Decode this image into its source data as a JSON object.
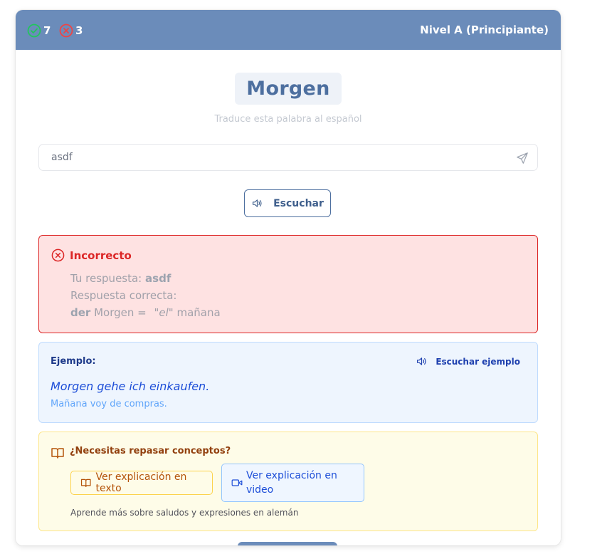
{
  "header": {
    "correct_count": "7",
    "wrong_count": "3",
    "level": "Nivel A (Principiante)"
  },
  "word": {
    "text": "Morgen",
    "instruction": "Traduce esta palabra al español"
  },
  "answer": {
    "value": "asdf"
  },
  "listen_button": "Escuchar",
  "feedback": {
    "title": "Incorrecto",
    "your_answer_label": "Tu respuesta:",
    "your_answer": "asdf",
    "correct_label": "Respuesta correcta:",
    "article": "der",
    "noun": "Morgen =",
    "article_translation": "\"el\"",
    "translation": "mañana"
  },
  "example": {
    "title": "Ejemplo:",
    "listen_label": "Escuchar ejemplo",
    "sentence": "Morgen gehe ich einkaufen.",
    "translation": "Mañana voy de compras."
  },
  "review": {
    "title": "¿Necesitas repasar conceptos?",
    "text_button": "Ver explicación en texto",
    "video_button": "Ver explicación en video",
    "note": "Aprende más sobre saludos y expresiones en alemán"
  },
  "colors": {
    "header": "#6b8cba",
    "correct": "#22c55e",
    "wrong": "#ef4444"
  }
}
